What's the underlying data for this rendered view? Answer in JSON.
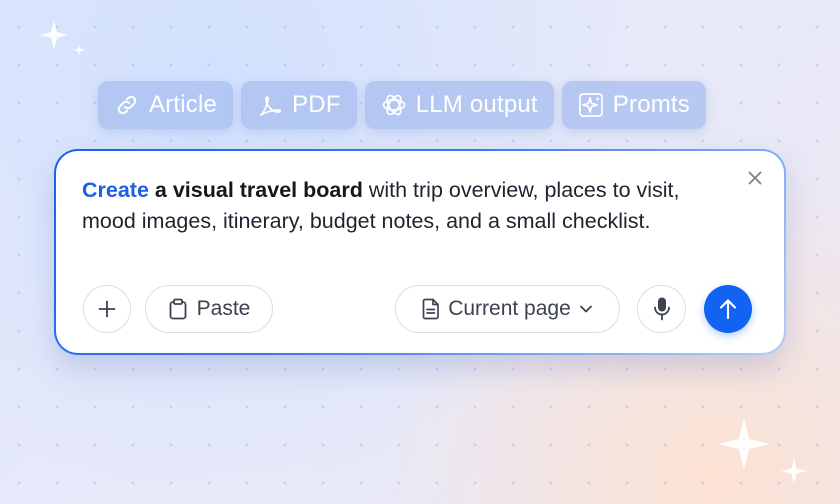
{
  "chips": [
    {
      "label": "Article",
      "icon": "link-icon"
    },
    {
      "label": "PDF",
      "icon": "pdf-icon"
    },
    {
      "label": "LLM output",
      "icon": "llm-icon"
    },
    {
      "label": "Promts",
      "icon": "sparkle-icon"
    }
  ],
  "prompt": {
    "highlight": "Create",
    "bold": "a visual travel board",
    "rest": " with trip overview, places to visit, mood images, itinerary, budget notes, and a small checklist."
  },
  "toolbar": {
    "paste_label": "Paste",
    "context_label": "Current page"
  },
  "colors": {
    "accent": "#1263f1",
    "chip_bg": "#a9bff0",
    "highlight_text": "#1d5ee8"
  }
}
